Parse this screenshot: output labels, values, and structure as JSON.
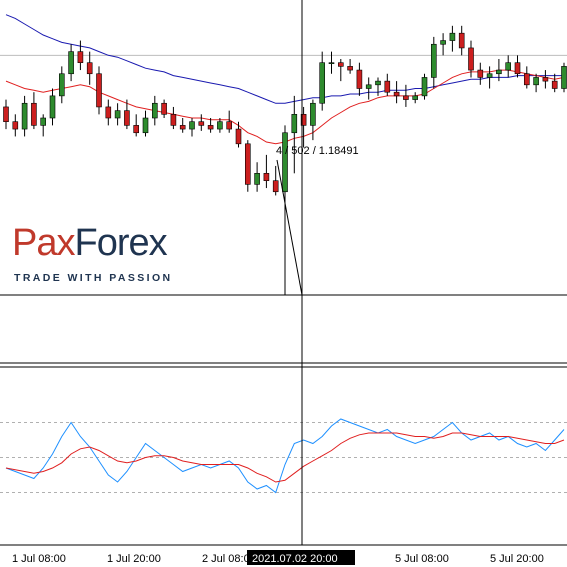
{
  "brand": {
    "name_part1": "Pax",
    "name_part2": "Forex",
    "tagline": "TRADE WITH PASSION"
  },
  "crosshair": {
    "label": "2021.07.02 20:00",
    "tooltip": "4 / 502 / 1.18491"
  },
  "chart_data": [
    {
      "type": "candlestick",
      "title": "",
      "colors": {
        "bull": "#2e8b2e",
        "bear": "#cc1f1f",
        "ma_fast": "#e02020",
        "ma_slow": "#1a1ab0",
        "crosshair": "#000000",
        "horizontal_line": "#bdbdbd"
      },
      "ylim": [
        1.176,
        1.192
      ],
      "horizontal_line": 1.189,
      "crosshair_price": 1.18491,
      "x_labels": [
        "1 Jul 08:00",
        "1 Jul 20:00",
        "2 Jul 08:00",
        "2021.07.02 20:00",
        "5 Jul 08:00",
        "5 Jul 20:00"
      ],
      "ohlc": [
        [
          1.1862,
          1.1866,
          1.185,
          1.1854
        ],
        [
          1.1854,
          1.1858,
          1.1846,
          1.185
        ],
        [
          1.185,
          1.1868,
          1.1846,
          1.1864
        ],
        [
          1.1864,
          1.187,
          1.185,
          1.1852
        ],
        [
          1.1852,
          1.1858,
          1.1846,
          1.1856
        ],
        [
          1.1856,
          1.1872,
          1.1852,
          1.1868
        ],
        [
          1.1868,
          1.1884,
          1.1864,
          1.188
        ],
        [
          1.188,
          1.1896,
          1.1876,
          1.1892
        ],
        [
          1.1892,
          1.1898,
          1.1882,
          1.1886
        ],
        [
          1.1886,
          1.1892,
          1.1874,
          1.188
        ],
        [
          1.188,
          1.1884,
          1.1858,
          1.1862
        ],
        [
          1.1862,
          1.1866,
          1.1852,
          1.1856
        ],
        [
          1.1856,
          1.1864,
          1.1852,
          1.186
        ],
        [
          1.186,
          1.1866,
          1.185,
          1.1852
        ],
        [
          1.1852,
          1.1858,
          1.1846,
          1.1848
        ],
        [
          1.1848,
          1.186,
          1.1846,
          1.1856
        ],
        [
          1.1856,
          1.1868,
          1.1852,
          1.1864
        ],
        [
          1.1864,
          1.1866,
          1.1856,
          1.1858
        ],
        [
          1.1858,
          1.1862,
          1.185,
          1.1852
        ],
        [
          1.1852,
          1.1856,
          1.1848,
          1.185
        ],
        [
          1.185,
          1.1856,
          1.1846,
          1.1854
        ],
        [
          1.1854,
          1.1858,
          1.1849,
          1.1852
        ],
        [
          1.1852,
          1.1856,
          1.1848,
          1.185
        ],
        [
          1.185,
          1.1856,
          1.1848,
          1.1854
        ],
        [
          1.1854,
          1.186,
          1.1848,
          1.185
        ],
        [
          1.185,
          1.1854,
          1.184,
          1.1842
        ],
        [
          1.1842,
          1.1844,
          1.1816,
          1.182
        ],
        [
          1.182,
          1.1832,
          1.1816,
          1.1826
        ],
        [
          1.1826,
          1.1836,
          1.1818,
          1.1822
        ],
        [
          1.1822,
          1.183,
          1.1814,
          1.1816
        ],
        [
          1.1816,
          1.1852,
          1.176,
          1.1848
        ],
        [
          1.1848,
          1.1868,
          1.1826,
          1.1858
        ],
        [
          1.1858,
          1.1862,
          1.184,
          1.1852
        ],
        [
          1.1852,
          1.1866,
          1.1844,
          1.1864
        ],
        [
          1.1864,
          1.1892,
          1.186,
          1.1886
        ],
        [
          1.1886,
          1.1892,
          1.188,
          1.1886
        ],
        [
          1.1886,
          1.1888,
          1.1876,
          1.1884
        ],
        [
          1.1884,
          1.1888,
          1.188,
          1.1882
        ],
        [
          1.1882,
          1.1886,
          1.1868,
          1.1872
        ],
        [
          1.1872,
          1.1878,
          1.1866,
          1.1874
        ],
        [
          1.1874,
          1.1878,
          1.1868,
          1.1876
        ],
        [
          1.1876,
          1.188,
          1.1868,
          1.187
        ],
        [
          1.187,
          1.1876,
          1.1864,
          1.1868
        ],
        [
          1.1868,
          1.1874,
          1.1862,
          1.1866
        ],
        [
          1.1866,
          1.187,
          1.1864,
          1.1868
        ],
        [
          1.1868,
          1.188,
          1.1866,
          1.1878
        ],
        [
          1.1878,
          1.19,
          1.1872,
          1.1896
        ],
        [
          1.1896,
          1.1902,
          1.189,
          1.1898
        ],
        [
          1.1898,
          1.1906,
          1.1892,
          1.1902
        ],
        [
          1.1902,
          1.1906,
          1.189,
          1.1894
        ],
        [
          1.1894,
          1.1898,
          1.1878,
          1.1882
        ],
        [
          1.1882,
          1.1886,
          1.1874,
          1.1878
        ],
        [
          1.1878,
          1.1884,
          1.1872,
          1.188
        ],
        [
          1.188,
          1.1888,
          1.1876,
          1.1882
        ],
        [
          1.1882,
          1.189,
          1.1878,
          1.1886
        ],
        [
          1.1886,
          1.189,
          1.1878,
          1.188
        ],
        [
          1.188,
          1.1884,
          1.1872,
          1.1874
        ],
        [
          1.1874,
          1.188,
          1.187,
          1.1878
        ],
        [
          1.1878,
          1.1882,
          1.1872,
          1.1876
        ],
        [
          1.1876,
          1.188,
          1.187,
          1.1872
        ],
        [
          1.1872,
          1.1886,
          1.187,
          1.1884
        ]
      ],
      "ma_fast": [
        1.1876,
        1.1874,
        1.1872,
        1.1871,
        1.187,
        1.1871,
        1.1872,
        1.1873,
        1.1874,
        1.1873,
        1.187,
        1.1868,
        1.1866,
        1.1864,
        1.1862,
        1.1861,
        1.186,
        1.1859,
        1.1858,
        1.1857,
        1.1856,
        1.1856,
        1.1855,
        1.1855,
        1.1855,
        1.1852,
        1.1848,
        1.1846,
        1.1843,
        1.1842,
        1.1843,
        1.1845,
        1.1846,
        1.1848,
        1.1852,
        1.1856,
        1.1859,
        1.1862,
        1.1864,
        1.1865,
        1.1867,
        1.1868,
        1.1868,
        1.1868,
        1.1868,
        1.1869,
        1.1872,
        1.1875,
        1.1878,
        1.188,
        1.1881,
        1.1881,
        1.1881,
        1.1882,
        1.1882,
        1.1881,
        1.188,
        1.1879,
        1.1878,
        1.1877,
        1.1878
      ],
      "ma_slow": [
        1.1912,
        1.191,
        1.1907,
        1.1904,
        1.1901,
        1.1899,
        1.1897,
        1.1896,
        1.1895,
        1.1894,
        1.1892,
        1.189,
        1.1889,
        1.1887,
        1.1885,
        1.1883,
        1.1882,
        1.1881,
        1.1879,
        1.1878,
        1.1877,
        1.1876,
        1.1875,
        1.1874,
        1.1873,
        1.1872,
        1.187,
        1.1868,
        1.1866,
        1.1864,
        1.1864,
        1.1865,
        1.1866,
        1.1867,
        1.1867,
        1.1868,
        1.1868,
        1.1869,
        1.1869,
        1.187,
        1.187,
        1.1871,
        1.1871,
        1.1871,
        1.1872,
        1.1872,
        1.1873,
        1.1874,
        1.1875,
        1.1876,
        1.1877,
        1.1877,
        1.1878,
        1.1878,
        1.1878,
        1.1879,
        1.1879,
        1.1879,
        1.1879,
        1.1879,
        1.1879
      ]
    },
    {
      "type": "line",
      "title": "",
      "ylim": [
        0,
        100
      ],
      "levels": [
        70,
        50,
        30
      ],
      "colors": {
        "main": "#1e90ff",
        "signal": "#e02020",
        "level": "#b0b0b0"
      },
      "series": [
        {
          "values": [
            44,
            42,
            40,
            38,
            44,
            52,
            62,
            70,
            62,
            56,
            48,
            40,
            36,
            42,
            50,
            58,
            54,
            50,
            46,
            42,
            44,
            46,
            44,
            46,
            48,
            44,
            36,
            32,
            34,
            30,
            46,
            58,
            60,
            58,
            62,
            68,
            72,
            70,
            68,
            66,
            64,
            66,
            62,
            60,
            58,
            60,
            62,
            66,
            70,
            64,
            60,
            62,
            64,
            60,
            62,
            58,
            56,
            58,
            54,
            60,
            66
          ]
        },
        {
          "values": [
            44,
            43,
            42,
            41,
            42,
            44,
            47,
            52,
            55,
            56,
            54,
            51,
            48,
            47,
            48,
            50,
            51,
            51,
            50,
            48,
            47,
            46,
            46,
            46,
            46,
            46,
            44,
            41,
            39,
            36,
            37,
            41,
            45,
            48,
            51,
            54,
            58,
            61,
            63,
            64,
            64,
            64,
            64,
            63,
            62,
            62,
            61,
            62,
            64,
            64,
            63,
            62,
            62,
            62,
            62,
            61,
            60,
            59,
            58,
            58,
            60
          ]
        }
      ]
    }
  ]
}
